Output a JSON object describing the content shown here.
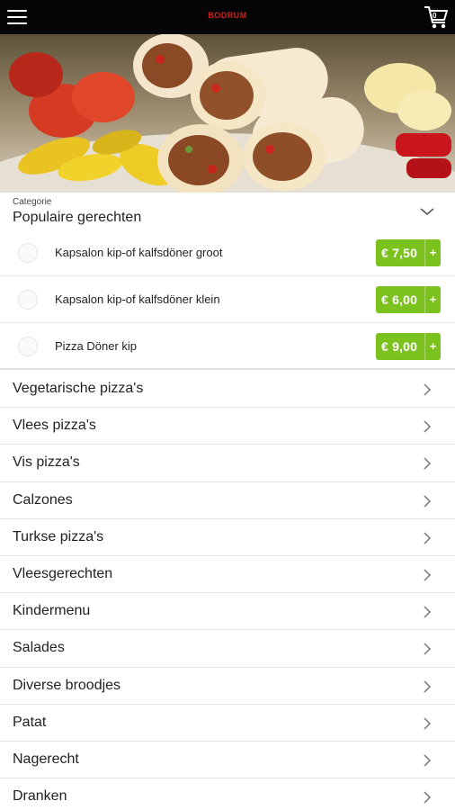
{
  "header": {
    "brand": "BODRUM",
    "cart_count": "0",
    "menu_icon": "hamburger-menu-icon",
    "cart_icon": "shopping-cart-icon"
  },
  "hero": {
    "image": "doner-wraps-with-peppers-photo"
  },
  "category": {
    "label": "Categorie",
    "title": "Populaire gerechten",
    "toggle_icon": "chevron-down-icon"
  },
  "products": [
    {
      "name": "Kapsalon kip-of kalfsdöner groot",
      "price": "€ 7,50",
      "add": "+"
    },
    {
      "name": "Kapsalon kip-of kalfsdöner klein",
      "price": "€ 6,00",
      "add": "+"
    },
    {
      "name": "Pizza Döner kip",
      "price": "€ 9,00",
      "add": "+"
    }
  ],
  "categories": [
    {
      "label": "Vegetarische pizza's"
    },
    {
      "label": "Vlees pizza's"
    },
    {
      "label": "Vis pizza's"
    },
    {
      "label": "Calzones"
    },
    {
      "label": "Turkse pizza's"
    },
    {
      "label": "Vleesgerechten"
    },
    {
      "label": "Kindermenu"
    },
    {
      "label": "Salades"
    },
    {
      "label": "Diverse broodjes"
    },
    {
      "label": "Patat"
    },
    {
      "label": "Nagerecht"
    },
    {
      "label": "Dranken"
    }
  ],
  "colors": {
    "topbar": "#050505",
    "brand": "#d41c1c",
    "price_button": "#7cc21f"
  }
}
